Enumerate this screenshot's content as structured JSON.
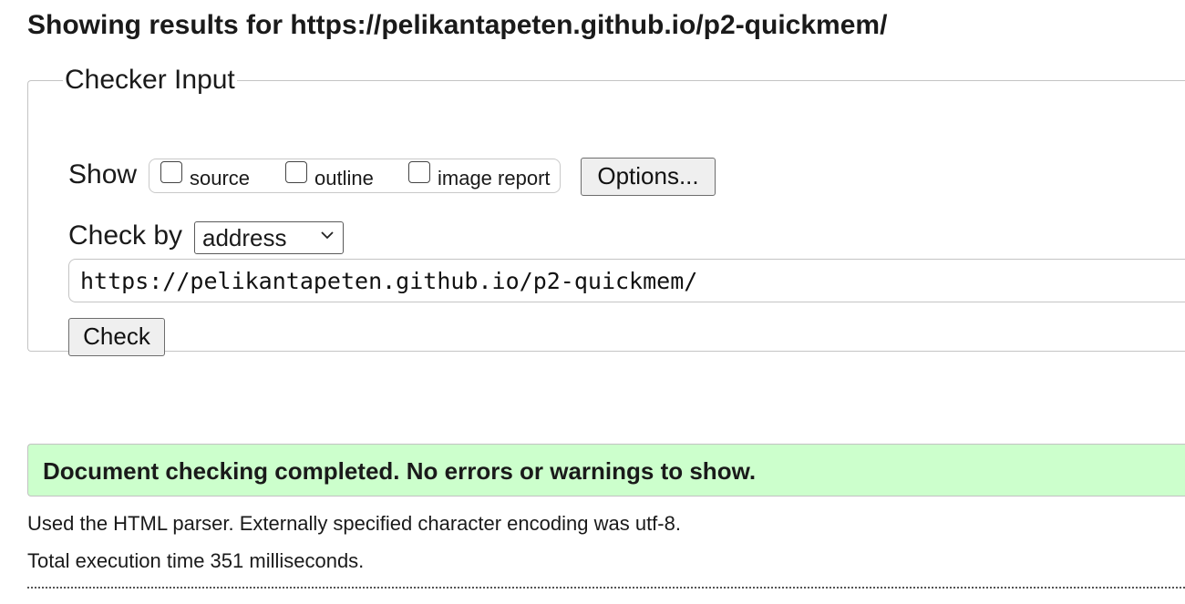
{
  "header": {
    "title": "Showing results for https://pelikantapeten.github.io/p2-quickmem/"
  },
  "checker_input": {
    "legend": "Checker Input",
    "show_label": "Show",
    "show_options": [
      {
        "label": "source",
        "checked": false
      },
      {
        "label": "outline",
        "checked": false
      },
      {
        "label": "image report",
        "checked": false
      }
    ],
    "options_button": "Options...",
    "check_by_label": "Check by",
    "check_by_value": "address",
    "url_value": "https://pelikantapeten.github.io/p2-quickmem/",
    "check_button": "Check"
  },
  "result": {
    "message": "Document checking completed. No errors or warnings to show.",
    "background_color": "#ccffcc",
    "parser_info": "Used the HTML parser. Externally specified character encoding was utf-8.",
    "execution_time": "Total execution time 351 milliseconds."
  }
}
